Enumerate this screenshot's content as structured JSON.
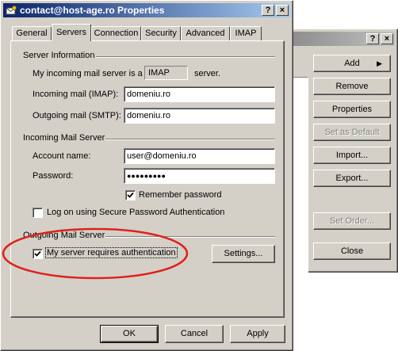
{
  "back_window": {
    "help_button": "?",
    "close_button": "×",
    "buttons": [
      {
        "label": "Add",
        "enabled": true,
        "has_arrow": true
      },
      {
        "label": "Remove",
        "enabled": true
      },
      {
        "label": "Properties",
        "enabled": true
      },
      {
        "label": "Set as Default",
        "enabled": false
      },
      {
        "label": "Import...",
        "enabled": true
      },
      {
        "label": "Export...",
        "enabled": true
      },
      {
        "label": "Set Order...",
        "enabled": false
      },
      {
        "label": "Close",
        "enabled": true
      }
    ]
  },
  "dialog": {
    "title": "contact@host-age.ro Properties",
    "help_button": "?",
    "close_button": "×",
    "tabs": [
      {
        "label": "General",
        "active": false
      },
      {
        "label": "Servers",
        "active": true
      },
      {
        "label": "Connection",
        "active": false
      },
      {
        "label": "Security",
        "active": false
      },
      {
        "label": "Advanced",
        "active": false
      },
      {
        "label": "IMAP",
        "active": false
      }
    ],
    "server_info": {
      "heading": "Server Information",
      "incoming_prefix": "My incoming mail server is a",
      "server_type": "IMAP",
      "incoming_suffix": "server.",
      "incoming_label": "Incoming mail (IMAP):",
      "incoming_value": "domeniu.ro",
      "outgoing_label": "Outgoing mail (SMTP):",
      "outgoing_value": "domeniu.ro"
    },
    "incoming_server": {
      "heading": "Incoming Mail Server",
      "account_label": "Account name:",
      "account_value": "user@domeniu.ro",
      "password_label": "Password:",
      "password_value": "●●●●●●●●●",
      "remember_label": "Remember password",
      "remember_checked": true,
      "spa_label": "Log on using Secure Password Authentication",
      "spa_checked": false
    },
    "outgoing_server": {
      "heading": "Outgoing Mail Server",
      "auth_label": "My server requires authentication",
      "auth_checked": true,
      "settings_button": "Settings..."
    },
    "footer": {
      "ok": "OK",
      "cancel": "Cancel",
      "apply": "Apply"
    }
  },
  "colors": {
    "face": "#d4d0c8",
    "title_active": "#0a246a",
    "highlight_ellipse": "#e0201a"
  }
}
